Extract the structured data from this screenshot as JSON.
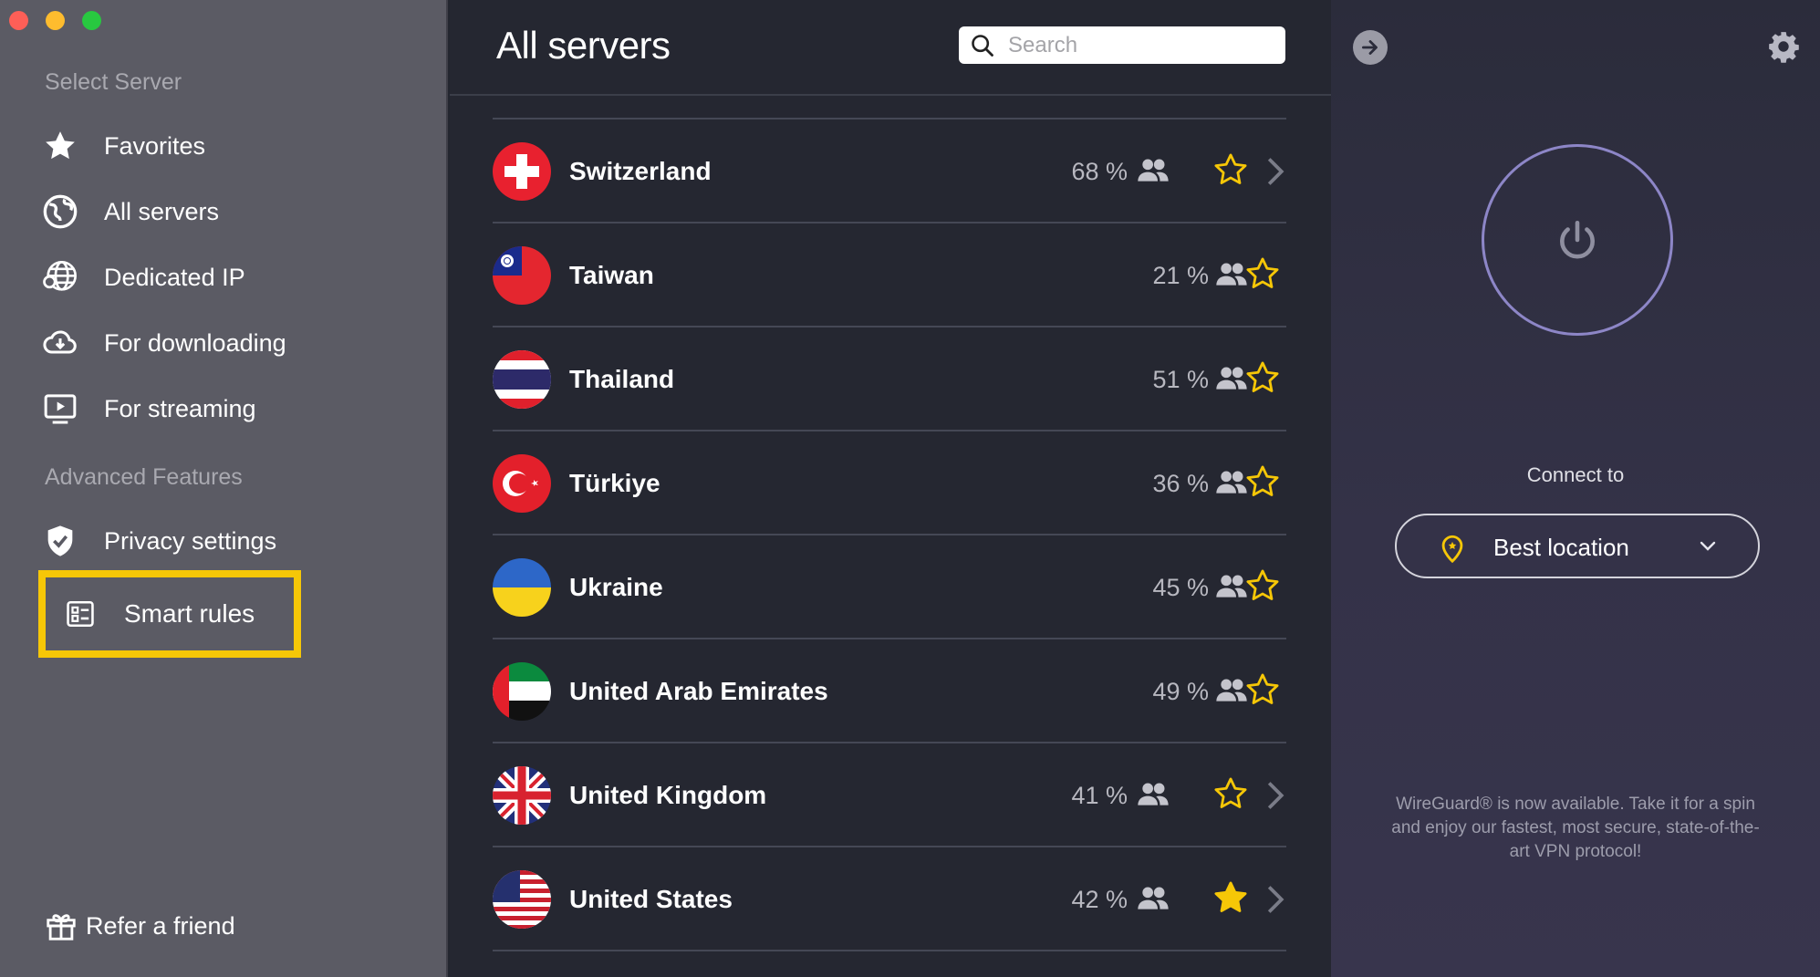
{
  "sidebar": {
    "section_select": "Select Server",
    "items": [
      {
        "label": "Favorites",
        "icon": "star-icon"
      },
      {
        "label": "All servers",
        "icon": "globe-icon"
      },
      {
        "label": "Dedicated IP",
        "icon": "dedicated-ip-icon"
      },
      {
        "label": "For downloading",
        "icon": "cloud-download-icon"
      },
      {
        "label": "For streaming",
        "icon": "play-screen-icon"
      }
    ],
    "section_advanced": "Advanced Features",
    "privacy": {
      "label": "Privacy settings",
      "icon": "shield-check-icon"
    },
    "smart_rules": {
      "label": "Smart rules",
      "icon": "rules-list-icon",
      "highlight_color": "#f6c707"
    },
    "refer": {
      "label": "Refer a friend",
      "icon": "gift-icon"
    }
  },
  "main": {
    "title": "All servers",
    "search": {
      "placeholder": "Search"
    },
    "servers": [
      {
        "country": "Switzerland",
        "load": "68 %",
        "favorite": false,
        "has_chevron": true
      },
      {
        "country": "Taiwan",
        "load": "21 %",
        "favorite": false,
        "has_chevron": false
      },
      {
        "country": "Thailand",
        "load": "51 %",
        "favorite": false,
        "has_chevron": false
      },
      {
        "country": "Türkiye",
        "load": "36 %",
        "favorite": false,
        "has_chevron": false
      },
      {
        "country": "Ukraine",
        "load": "45 %",
        "favorite": false,
        "has_chevron": false
      },
      {
        "country": "United Arab Emirates",
        "load": "49 %",
        "favorite": false,
        "has_chevron": false
      },
      {
        "country": "United Kingdom",
        "load": "41 %",
        "favorite": false,
        "has_chevron": true
      },
      {
        "country": "United States",
        "load": "42 %",
        "favorite": true,
        "has_chevron": true
      }
    ]
  },
  "right": {
    "connect_label": "Connect to",
    "location": "Best location",
    "notice": "WireGuard® is now available. Take it for a spin and enjoy our fastest, most secure, state-of-the-art VPN protocol!"
  },
  "colors": {
    "accent_yellow": "#f6c707",
    "power_ring": "#8d86c7"
  }
}
